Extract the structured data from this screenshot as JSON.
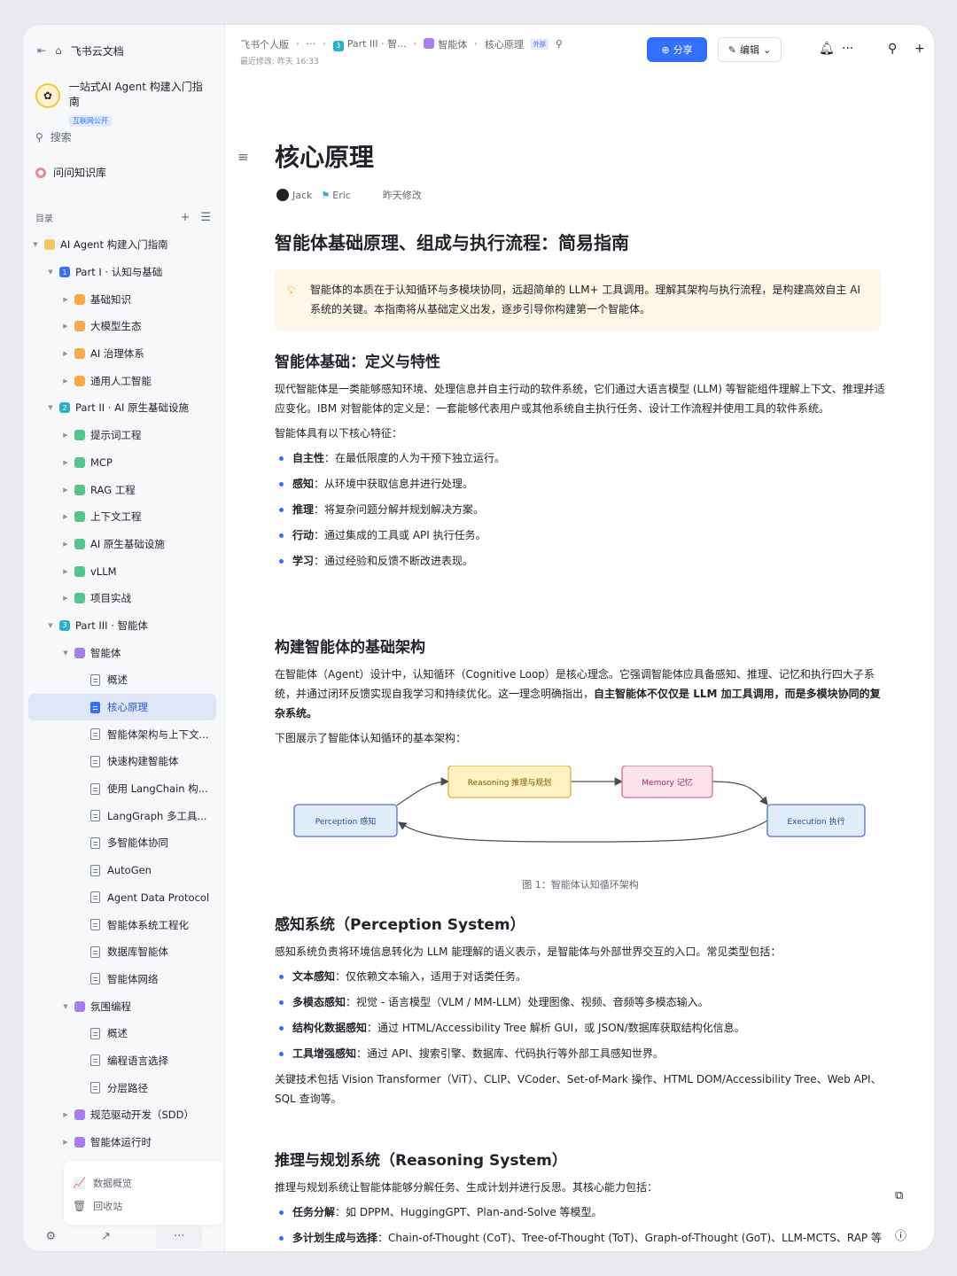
{
  "app": {
    "name": "飞书云文档"
  },
  "sidebar": {
    "kb_title": "一站式AI Agent 构建入门指南",
    "kb_badge": "互联网公开",
    "search": "搜索",
    "ask": "问问知识库",
    "toc": "目录",
    "tree": [
      {
        "label": "AI Agent 构建入门指南",
        "level": 0,
        "kind": "badge",
        "badge": "",
        "color": "b-yellow",
        "arrow": "down"
      },
      {
        "label": "Part I · 认知与基础",
        "level": 1,
        "kind": "badge",
        "badge": "1",
        "color": "b-blue",
        "arrow": "down"
      },
      {
        "label": "基础知识",
        "level": 2,
        "kind": "badge",
        "badge": "",
        "color": "b-orange",
        "arrow": "right"
      },
      {
        "label": "大模型生态",
        "level": 2,
        "kind": "badge",
        "badge": "",
        "color": "b-orange",
        "arrow": "right"
      },
      {
        "label": "AI 治理体系",
        "level": 2,
        "kind": "badge",
        "badge": "",
        "color": "b-orange",
        "arrow": "right"
      },
      {
        "label": "通用人工智能",
        "level": 2,
        "kind": "badge",
        "badge": "",
        "color": "b-orange",
        "arrow": "right"
      },
      {
        "label": "Part II · AI 原生基础设施",
        "level": 1,
        "kind": "badge",
        "badge": "2",
        "color": "b-teal",
        "arrow": "down"
      },
      {
        "label": "提示词工程",
        "level": 2,
        "kind": "badge",
        "badge": "",
        "color": "b-green",
        "arrow": "right"
      },
      {
        "label": "MCP",
        "level": 2,
        "kind": "badge",
        "badge": "",
        "color": "b-green",
        "arrow": "right"
      },
      {
        "label": "RAG 工程",
        "level": 2,
        "kind": "badge",
        "badge": "",
        "color": "b-green",
        "arrow": "right"
      },
      {
        "label": "上下文工程",
        "level": 2,
        "kind": "badge",
        "badge": "",
        "color": "b-green",
        "arrow": "right"
      },
      {
        "label": "AI 原生基础设施",
        "level": 2,
        "kind": "badge",
        "badge": "",
        "color": "b-green",
        "arrow": "right"
      },
      {
        "label": "vLLM",
        "level": 2,
        "kind": "badge",
        "badge": "",
        "color": "b-green",
        "arrow": "right"
      },
      {
        "label": "项目实战",
        "level": 2,
        "kind": "badge",
        "badge": "",
        "color": "b-green",
        "arrow": "right"
      },
      {
        "label": "Part III · 智能体",
        "level": 1,
        "kind": "badge",
        "badge": "3",
        "color": "b-teal",
        "arrow": "down"
      },
      {
        "label": "智能体",
        "level": 2,
        "kind": "badge",
        "badge": "",
        "color": "b-purple",
        "arrow": "down"
      },
      {
        "label": "概述",
        "level": 3,
        "kind": "doc",
        "arrow": "none"
      },
      {
        "label": "核心原理",
        "level": 3,
        "kind": "doc",
        "arrow": "none",
        "active": true
      },
      {
        "label": "智能体架构与上下文...",
        "level": 3,
        "kind": "doc",
        "arrow": "none"
      },
      {
        "label": "快速构建智能体",
        "level": 3,
        "kind": "doc",
        "arrow": "none"
      },
      {
        "label": "使用 LangChain 构...",
        "level": 3,
        "kind": "doc",
        "arrow": "none"
      },
      {
        "label": "LangGraph 多工具...",
        "level": 3,
        "kind": "doc",
        "arrow": "none"
      },
      {
        "label": "多智能体协同",
        "level": 3,
        "kind": "doc",
        "arrow": "none"
      },
      {
        "label": "AutoGen",
        "level": 3,
        "kind": "doc",
        "arrow": "none"
      },
      {
        "label": "Agent Data Protocol",
        "level": 3,
        "kind": "doc",
        "arrow": "none"
      },
      {
        "label": "智能体系统工程化",
        "level": 3,
        "kind": "doc",
        "arrow": "none"
      },
      {
        "label": "数据库智能体",
        "level": 3,
        "kind": "doc",
        "arrow": "none"
      },
      {
        "label": "智能体网络",
        "level": 3,
        "kind": "doc",
        "arrow": "none"
      },
      {
        "label": "氛围编程",
        "level": 2,
        "kind": "badge",
        "badge": "",
        "color": "b-purple",
        "arrow": "down"
      },
      {
        "label": "概述",
        "level": 3,
        "kind": "doc",
        "arrow": "none"
      },
      {
        "label": "编程语言选择",
        "level": 3,
        "kind": "doc",
        "arrow": "none"
      },
      {
        "label": "分层路径",
        "level": 3,
        "kind": "doc",
        "arrow": "none"
      },
      {
        "label": "规范驱动开发（SDD）",
        "level": 2,
        "kind": "badge",
        "badge": "",
        "color": "b-purple",
        "arrow": "right"
      },
      {
        "label": "智能体运行时",
        "level": 2,
        "kind": "badge",
        "badge": "",
        "color": "b-purple",
        "arrow": "right"
      }
    ],
    "footer_stats": "数据概览",
    "footer_trash": "回收站"
  },
  "topbar": {
    "crumb1": "飞书个人版",
    "crumb2": "···",
    "crumb3": "Part III · 智...",
    "crumb3_badge": "3",
    "crumb4": "智能体",
    "crumb5": "核心原理",
    "crumb_tag": "外部",
    "last_modified": "最近修改: 昨天 16:33",
    "share": "分享",
    "edit": "编辑"
  },
  "doc": {
    "title": "核心原理",
    "author1": "Jack",
    "author2": "Eric",
    "modified": "昨天修改",
    "h1": "智能体基础原理、组成与执行流程：简易指南",
    "callout": "智能体的本质在于认知循环与多模块协同，远超简单的 LLM+ 工具调用。理解其架构与执行流程，是构建高效自主 AI 系统的关键。本指南将从基础定义出发，逐步引导你构建第一个智能体。",
    "s1": {
      "title": "智能体基础：定义与特性",
      "p1": "现代智能体是一类能够感知环境、处理信息并自主行动的软件系统，它们通过大语言模型 (LLM) 等智能组件理解上下文、推理并适应变化。IBM 对智能体的定义是：一套能够代表用户或其他系统自主执行任务、设计工作流程并使用工具的软件系统。",
      "p2": "智能体具有以下核心特征：",
      "items": [
        {
          "k": "自主性",
          "v": "：在最低限度的人为干预下独立运行。"
        },
        {
          "k": "感知",
          "v": "：从环境中获取信息并进行处理。"
        },
        {
          "k": "推理",
          "v": "：将复杂问题分解并规划解决方案。"
        },
        {
          "k": "行动",
          "v": "：通过集成的工具或 API 执行任务。"
        },
        {
          "k": "学习",
          "v": "：通过经验和反馈不断改进表现。"
        }
      ]
    },
    "s2": {
      "title": "构建智能体的基础架构",
      "p1a": "在智能体（Agent）设计中，认知循环（Cognitive Loop）是核心理念。它强调智能体应具备感知、推理、记忆和执行四大子系统，并通过闭环反馈实现自我学习和持续优化。这一理念明确指出，",
      "p1b": "自主智能体不仅仅是 LLM 加工具调用，而是多模块协同的复杂系统。",
      "p2": "下图展示了智能体认知循环的基本架构："
    },
    "diagram": {
      "perception": "Perception 感知",
      "reasoning": "Reasoning 推理与规划",
      "memory": "Memory 记忆",
      "execution": "Execution 执行",
      "caption": "图 1：智能体认知循环架构"
    },
    "s3": {
      "title": "感知系统（Perception System）",
      "p1": "感知系统负责将环境信息转化为 LLM 能理解的语义表示，是智能体与外部世界交互的入口。常见类型包括：",
      "items": [
        {
          "k": "文本感知",
          "v": "：仅依赖文本输入，适用于对话类任务。"
        },
        {
          "k": "多模态感知",
          "v": "：视觉 - 语言模型（VLM / MM-LLM）处理图像、视频、音频等多模态输入。"
        },
        {
          "k": "结构化数据感知",
          "v": "：通过 HTML/Accessibility Tree 解析 GUI，或 JSON/数据库获取结构化信息。"
        },
        {
          "k": "工具增强感知",
          "v": "：通过 API、搜索引擎、数据库、代码执行等外部工具感知世界。"
        }
      ],
      "p2": "关键技术包括 Vision Transformer（ViT）、CLIP、VCoder、Set-of-Mark 操作、HTML DOM/Accessibility Tree、Web API、SQL 查询等。"
    },
    "s4": {
      "title": "推理与规划系统（Reasoning System）",
      "p1": "推理与规划系统让智能体能够分解任务、生成计划并进行反思。其核心能力包括：",
      "items": [
        {
          "k": "任务分解",
          "v": "：如 DPPM、HuggingGPT、Plan-and-Solve 等模型。"
        },
        {
          "k": "多计划生成与选择",
          "v": "：Chain-of-Thought (CoT)、Tree-of-Thought (ToT)、Graph-of-Thought (GoT)、LLM-MCTS、RAP 等方法。"
        }
      ]
    }
  }
}
